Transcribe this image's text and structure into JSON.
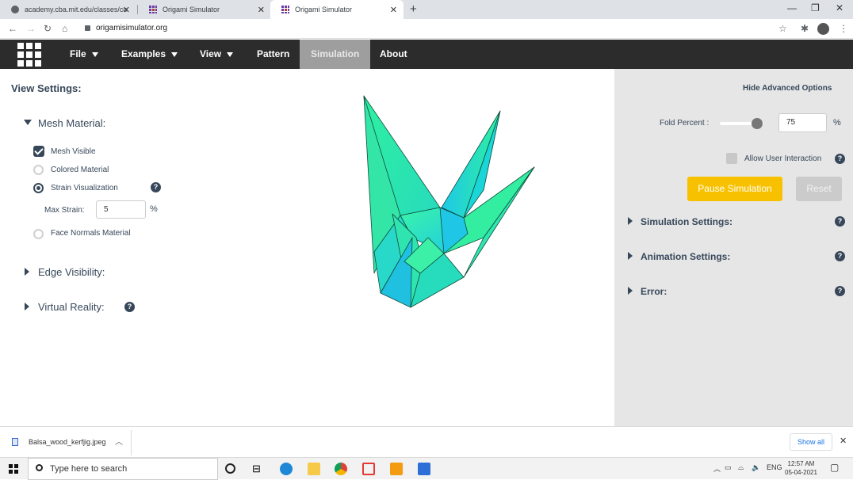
{
  "browser": {
    "tabs": [
      {
        "title": "academy.cba.mit.edu/classes/co",
        "icon": "globe-icon"
      },
      {
        "title": "Origami Simulator",
        "icon": "origami-grid-icon"
      },
      {
        "title": "Origami Simulator",
        "icon": "origami-grid-icon",
        "active": true
      }
    ],
    "url": "origamisimulator.org"
  },
  "nav": {
    "file": "File",
    "examples": "Examples",
    "view": "View",
    "pattern": "Pattern",
    "simulation": "Simulation",
    "about": "About"
  },
  "left": {
    "title": "View Settings:",
    "mesh_material": "Mesh Material:",
    "mesh_visible": "Mesh Visible",
    "colored_material": "Colored Material",
    "strain_visualization": "Strain Visualization",
    "max_strain_label": "Max Strain:",
    "max_strain_value": "5",
    "max_strain_unit": "%",
    "face_normals": "Face Normals Material",
    "edge_visibility": "Edge Visibility:",
    "virtual_reality": "Virtual Reality:",
    "help": "?"
  },
  "right": {
    "hide_advanced": "Hide Advanced Options",
    "fold_percent_label": "Fold Percent :",
    "fold_percent_value": "75",
    "fold_percent_unit": "%",
    "fold_fraction": 0.75,
    "allow_interaction": "Allow User Interaction",
    "pause_button": "Pause Simulation",
    "reset_button": "Reset",
    "simulation_settings": "Simulation Settings:",
    "animation_settings": "Animation Settings:",
    "error": "Error:",
    "help": "?"
  },
  "download": {
    "filename": "Balsa_wood_kerfjig.jpeg",
    "show_all": "Show all"
  },
  "taskbar": {
    "search_placeholder": "Type here to search",
    "language": "ENG",
    "time": "12:57 AM",
    "date": "05-04-2021"
  },
  "colors": {
    "nav_bg": "#2c2c2c",
    "accent_text": "#37475a",
    "pause_button": "#f8c100",
    "panel_bg": "#e6e6e6",
    "crane_green": "#2ef0a0",
    "crane_cyan": "#1ec8e8"
  }
}
